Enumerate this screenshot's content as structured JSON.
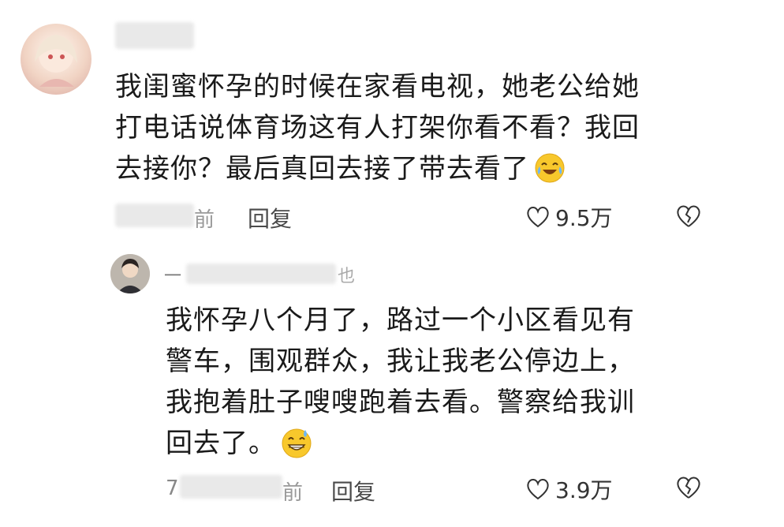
{
  "comments": [
    {
      "text_lines": [
        "我闺蜜怀孕的时候在家看电视，她老公给她",
        "打电话说体育场这有人打架你看不看？我回",
        "去接你？最后真回去接了带去看了"
      ],
      "time_fragment": "前",
      "reply_label": "回复",
      "likes": "9.5万",
      "emoji": "laughing-tears-emoji"
    },
    {
      "name_fragment": "一",
      "name_tail": "也",
      "text_lines": [
        "我怀孕八个月了，路过一个小区看见有",
        "警车，围观群众，我让我老公停边上，",
        "我抱着肚子嗖嗖跑着去看。警察给我训",
        "回去了。"
      ],
      "time_prefix": "7",
      "time_fragment": "前",
      "reply_label": "回复",
      "likes": "3.9万",
      "emoji": "grinning-sweat-emoji"
    }
  ],
  "colors": {
    "text": "#1a1a1a",
    "meta": "#555555",
    "emoji": "#f8c82c"
  }
}
